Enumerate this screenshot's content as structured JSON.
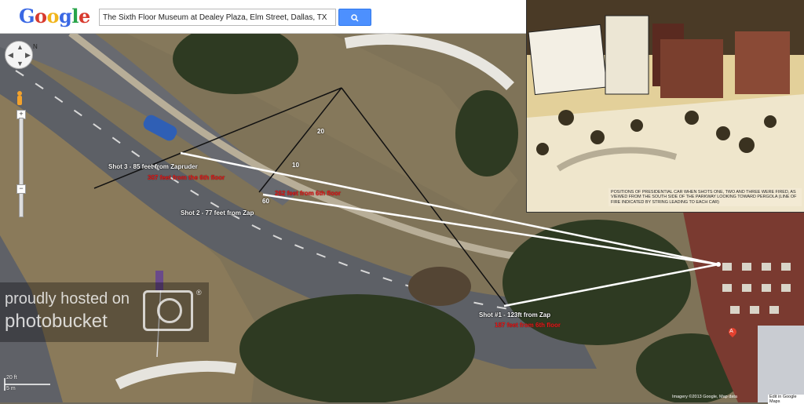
{
  "header": {
    "logo_letters": [
      {
        "ch": "G",
        "color": "#3a68e4"
      },
      {
        "ch": "o",
        "color": "#d83a2e"
      },
      {
        "ch": "o",
        "color": "#f1b51c"
      },
      {
        "ch": "g",
        "color": "#3a68e4"
      },
      {
        "ch": "l",
        "color": "#28a44a"
      },
      {
        "ch": "e",
        "color": "#d83a2e"
      }
    ],
    "search_value": "The Sixth Floor Museum at Dealey Plaza, Elm Street, Dallas, TX",
    "search_button_icon": "search-icon"
  },
  "map_controls": {
    "compass_letter": "N",
    "zoom_in": "+",
    "zoom_out": "−"
  },
  "shot_labels": {
    "shot3_white": "Shot 3 - 85 feet from Zapruder",
    "shot3_red": "307 feet from the 6th floor",
    "shot2_red": "262 feet from 6th floor",
    "shot2_white": "Shot 2 - 77 feet from Zap",
    "shot1_white": "Shot #1 - 123ft from Zap",
    "shot1_red": "187 feet from 6th floor"
  },
  "ruler_marks": {
    "m20": "20",
    "m10": "10",
    "m60": "60"
  },
  "photo": {
    "caption": "POSITIONS OF PRESIDENTIAL CAR WHEN SHOTS ONE, TWO AND THREE WERE FIRED, AS VIEWED FROM THE SOUTH SIDE OF THE PARKWAY LOOKING TOWARD PERGOLA (LINE OF FIRE INDICATED BY STRING LEADING TO EACH CAR)"
  },
  "watermark": {
    "line1": "proudly hosted on",
    "line2": "photobucket",
    "reg": "®"
  },
  "scale": {
    "feet": "20 ft",
    "meters": "5 m"
  },
  "footer": {
    "imagery": "Imagery ©2013 Google, Map data",
    "edit_link": "Edit in Google Maps"
  },
  "marker": {
    "letter": "A"
  },
  "colors": {
    "road": "#5d6066",
    "grass": "#7b6e52",
    "tree": "#2c3b21",
    "sightline": "#ffffff",
    "label_red": "#e21b1b",
    "search_blue": "#4d90fe"
  }
}
